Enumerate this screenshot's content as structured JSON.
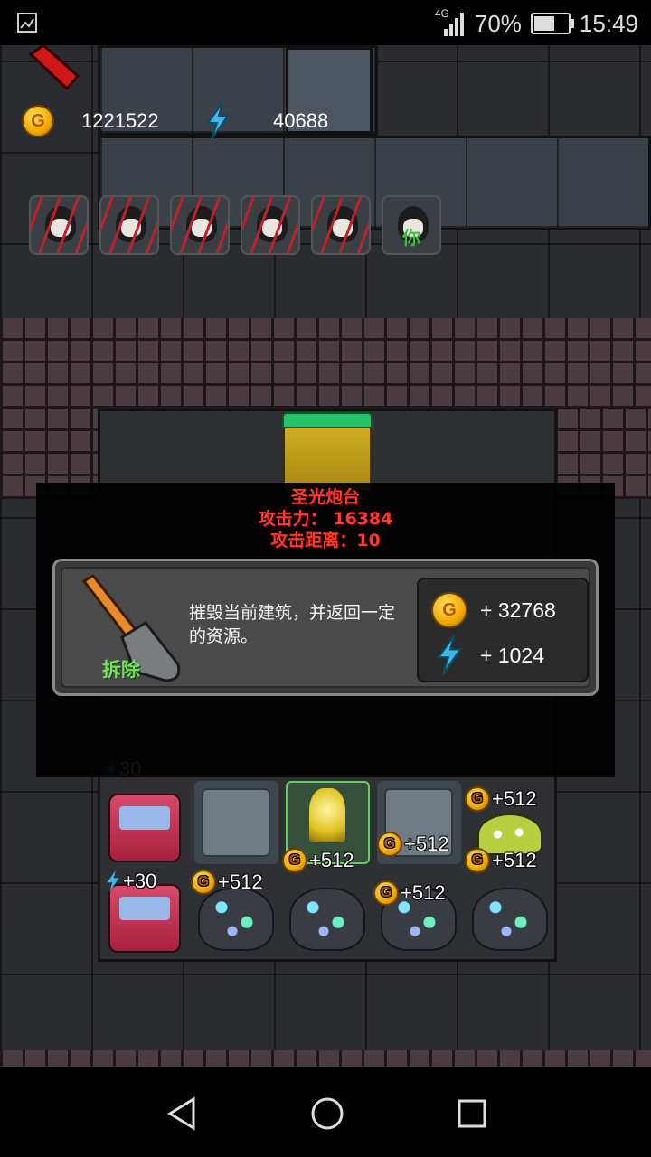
{
  "status_bar": {
    "network": "4G",
    "battery": "70%",
    "battery_level": 0.7,
    "time": "15:49"
  },
  "resources": {
    "gold": "1221522",
    "energy": "40688",
    "coin_letter": "G"
  },
  "player_slots": [
    {
      "state": "destroyed"
    },
    {
      "state": "destroyed"
    },
    {
      "state": "destroyed"
    },
    {
      "state": "destroyed"
    },
    {
      "state": "destroyed"
    },
    {
      "state": "self",
      "label": "你"
    }
  ],
  "building_info": {
    "name": "圣光炮台",
    "attack": "攻击力： 16384",
    "range": "攻击距离：10"
  },
  "demolish_panel": {
    "label": "拆除",
    "description": "摧毁当前建筑，并返回一定的资源。",
    "reward_gold": "+  32768",
    "reward_energy": "+  1024"
  },
  "floating_labels": {
    "plus512": "+512",
    "plus30": "+30",
    "plus30_partial": "30"
  },
  "colors": {
    "info_text": "#ff3a2a",
    "demolish_label": "#74e05a",
    "door_bar": "#27c26a"
  }
}
